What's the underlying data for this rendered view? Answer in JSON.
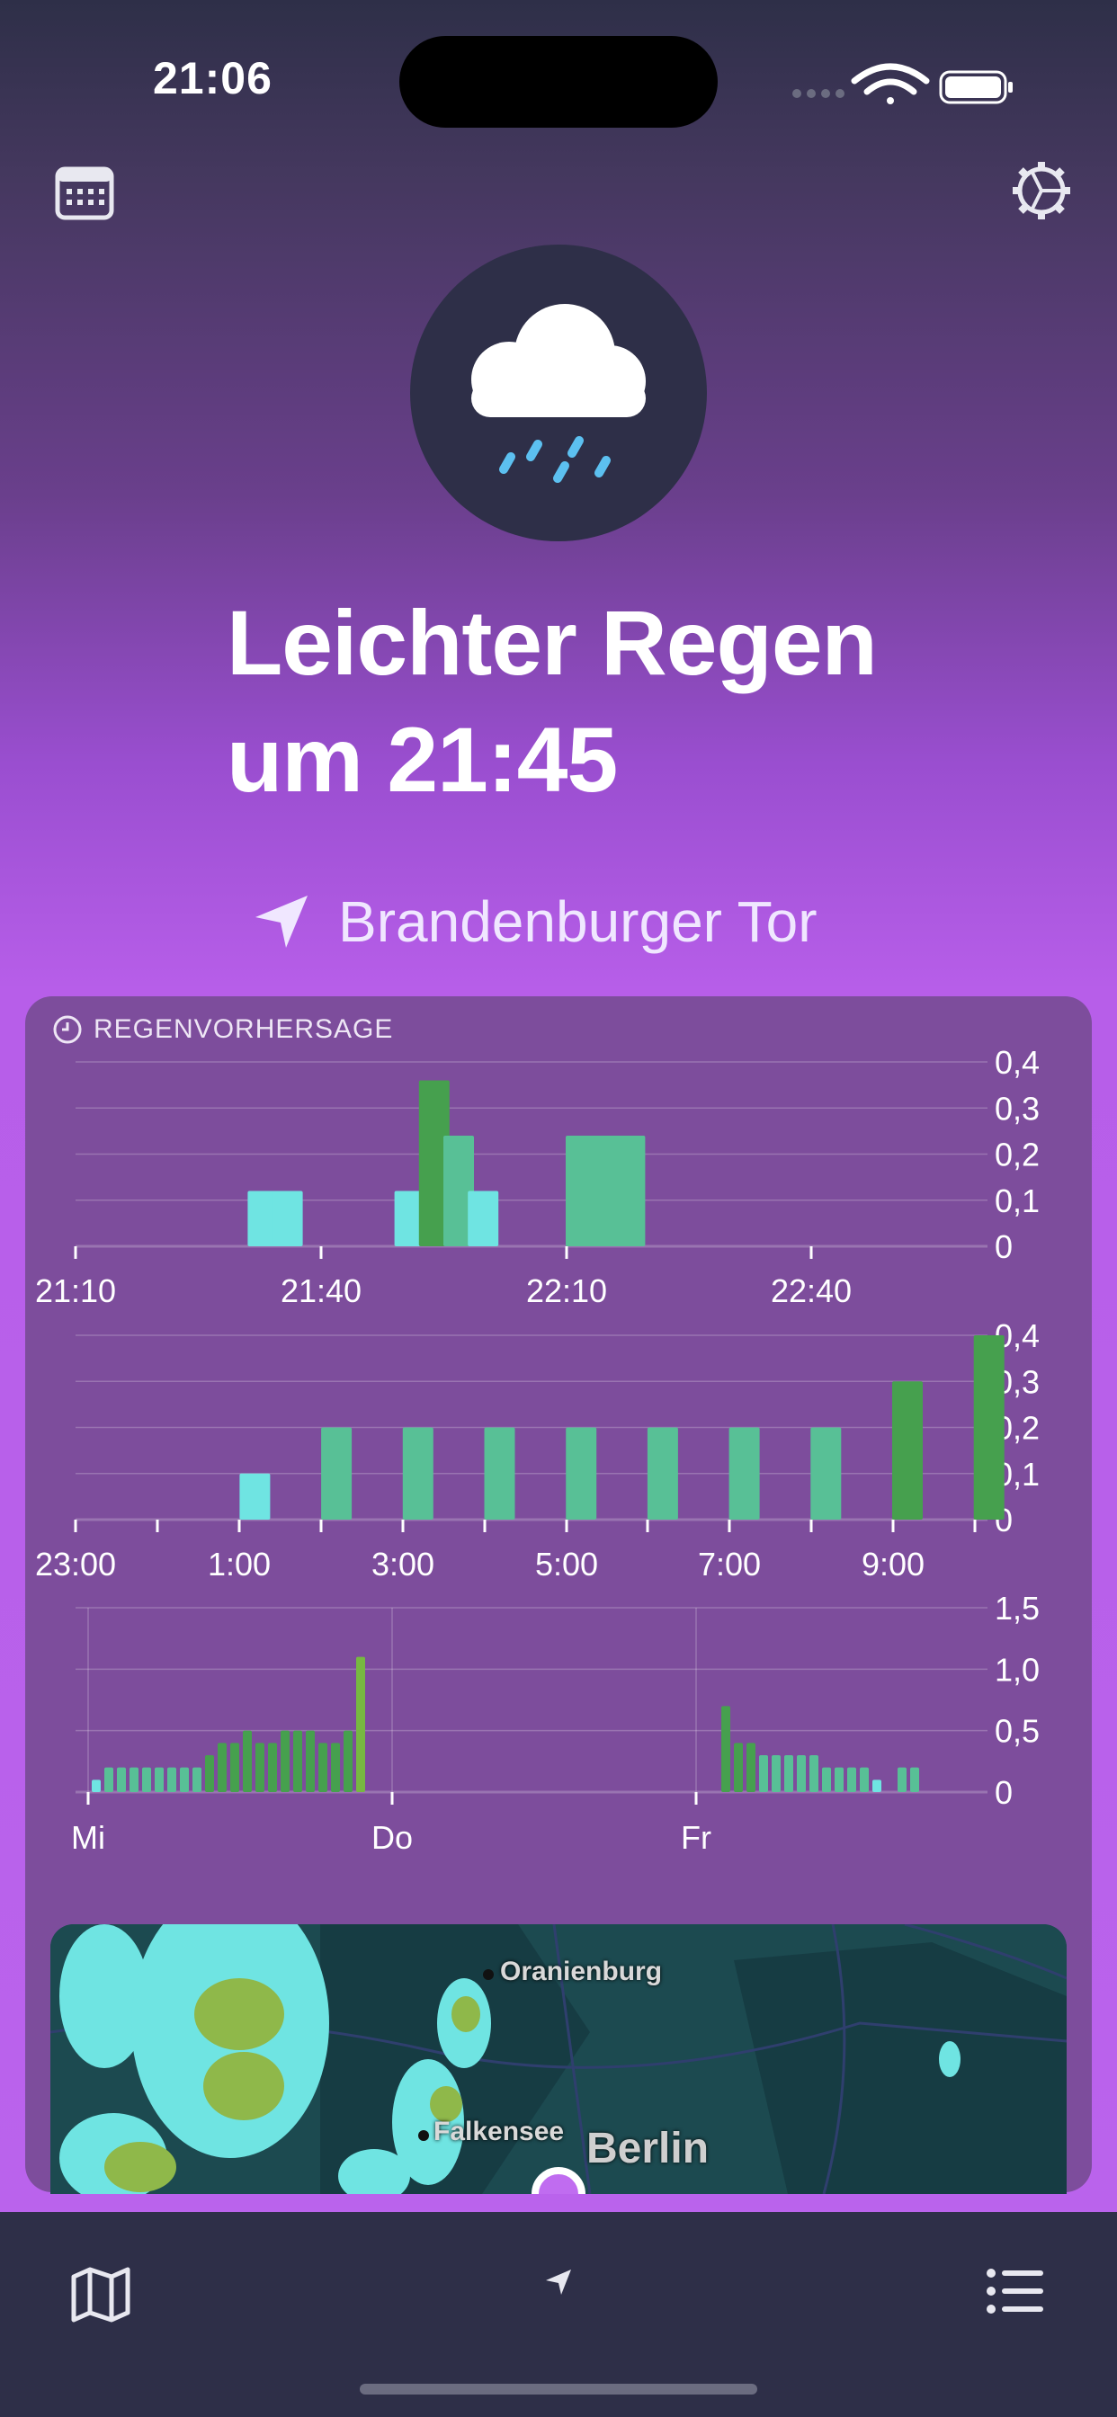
{
  "status_bar": {
    "time": "21:06"
  },
  "headline": {
    "line1": "Leichter Regen",
    "line2": "um 21:45"
  },
  "location": {
    "name": "Brandenburger Tor",
    "icon": "location-arrow-icon"
  },
  "forecast": {
    "title": "REGENVORHERSAGE"
  },
  "colors": {
    "cyan": "#6fe4e2",
    "green_light": "#58c096",
    "green_dark": "#46a04e",
    "green_lime": "#77b841"
  },
  "chart_data": [
    {
      "type": "bar",
      "x_tick_labels": [
        "21:10",
        "21:40",
        "22:10",
        "22:40"
      ],
      "y_tick_labels": [
        "0,4",
        "0,3",
        "0,2",
        "0,1",
        "0"
      ],
      "ylim": [
        0,
        0.4
      ],
      "bars": [
        {
          "slot": 7,
          "value": 0.12,
          "kind": "cyan"
        },
        {
          "slot": 8,
          "value": 0.12,
          "kind": "cyan"
        },
        {
          "slot": 13,
          "value": 0.12,
          "kind": "cyan"
        },
        {
          "slot": 14,
          "value": 0.36,
          "kind": "dark"
        },
        {
          "slot": 15,
          "value": 0.24,
          "kind": "light"
        },
        {
          "slot": 16,
          "value": 0.12,
          "kind": "cyan"
        },
        {
          "slot": 20,
          "value": 0.24,
          "kind": "light"
        },
        {
          "slot": 21,
          "value": 0.24,
          "kind": "light"
        },
        {
          "slot": 22,
          "value": 0.24,
          "kind": "light"
        }
      ]
    },
    {
      "type": "bar",
      "x_tick_labels": [
        "23:00",
        "1:00",
        "3:00",
        "5:00",
        "7:00",
        "9:00"
      ],
      "y_tick_labels": [
        "0,4",
        "0,3",
        "0,2",
        "0,1",
        "0"
      ],
      "ylim": [
        0,
        0.4
      ],
      "bars": [
        {
          "slot": 2,
          "value": 0.1,
          "kind": "cyan"
        },
        {
          "slot": 3,
          "value": 0.2,
          "kind": "light"
        },
        {
          "slot": 4,
          "value": 0.2,
          "kind": "light"
        },
        {
          "slot": 5,
          "value": 0.2,
          "kind": "light"
        },
        {
          "slot": 6,
          "value": 0.2,
          "kind": "light"
        },
        {
          "slot": 7,
          "value": 0.2,
          "kind": "light"
        },
        {
          "slot": 8,
          "value": 0.2,
          "kind": "light"
        },
        {
          "slot": 9,
          "value": 0.2,
          "kind": "light"
        },
        {
          "slot": 10,
          "value": 0.3,
          "kind": "dark"
        },
        {
          "slot": 11,
          "value": 0.4,
          "kind": "dark"
        }
      ]
    },
    {
      "type": "bar",
      "x_tick_labels": [
        "Mi",
        "Do",
        "Fr"
      ],
      "y_tick_labels": [
        "1,5",
        "1,0",
        "0,5",
        "0"
      ],
      "ylim": [
        0,
        1.5
      ],
      "bars": [
        {
          "slot": 0,
          "value": 0.1,
          "kind": "cyan"
        },
        {
          "slot": 1,
          "value": 0.2,
          "kind": "light"
        },
        {
          "slot": 2,
          "value": 0.2,
          "kind": "light"
        },
        {
          "slot": 3,
          "value": 0.2,
          "kind": "light"
        },
        {
          "slot": 4,
          "value": 0.2,
          "kind": "light"
        },
        {
          "slot": 5,
          "value": 0.2,
          "kind": "light"
        },
        {
          "slot": 6,
          "value": 0.2,
          "kind": "light"
        },
        {
          "slot": 7,
          "value": 0.2,
          "kind": "light"
        },
        {
          "slot": 8,
          "value": 0.2,
          "kind": "light"
        },
        {
          "slot": 9,
          "value": 0.3,
          "kind": "dark"
        },
        {
          "slot": 10,
          "value": 0.4,
          "kind": "dark"
        },
        {
          "slot": 11,
          "value": 0.4,
          "kind": "dark"
        },
        {
          "slot": 12,
          "value": 0.5,
          "kind": "dark"
        },
        {
          "slot": 13,
          "value": 0.4,
          "kind": "dark"
        },
        {
          "slot": 14,
          "value": 0.4,
          "kind": "dark"
        },
        {
          "slot": 15,
          "value": 0.5,
          "kind": "dark"
        },
        {
          "slot": 16,
          "value": 0.5,
          "kind": "dark"
        },
        {
          "slot": 17,
          "value": 0.5,
          "kind": "dark"
        },
        {
          "slot": 18,
          "value": 0.4,
          "kind": "dark"
        },
        {
          "slot": 19,
          "value": 0.4,
          "kind": "dark"
        },
        {
          "slot": 20,
          "value": 0.5,
          "kind": "dark"
        },
        {
          "slot": 21,
          "value": 1.1,
          "kind": "lime"
        },
        {
          "slot": 50,
          "value": 0.7,
          "kind": "dark"
        },
        {
          "slot": 51,
          "value": 0.4,
          "kind": "dark"
        },
        {
          "slot": 52,
          "value": 0.4,
          "kind": "dark"
        },
        {
          "slot": 53,
          "value": 0.3,
          "kind": "light"
        },
        {
          "slot": 54,
          "value": 0.3,
          "kind": "light"
        },
        {
          "slot": 55,
          "value": 0.3,
          "kind": "light"
        },
        {
          "slot": 56,
          "value": 0.3,
          "kind": "light"
        },
        {
          "slot": 57,
          "value": 0.3,
          "kind": "light"
        },
        {
          "slot": 58,
          "value": 0.2,
          "kind": "light"
        },
        {
          "slot": 59,
          "value": 0.2,
          "kind": "light"
        },
        {
          "slot": 60,
          "value": 0.2,
          "kind": "light"
        },
        {
          "slot": 61,
          "value": 0.2,
          "kind": "light"
        },
        {
          "slot": 62,
          "value": 0.1,
          "kind": "cyan"
        },
        {
          "slot": 64,
          "value": 0.2,
          "kind": "light"
        },
        {
          "slot": 65,
          "value": 0.2,
          "kind": "light"
        }
      ]
    }
  ],
  "map": {
    "labels": [
      "Oranienburg",
      "Falkensee",
      "Berlin"
    ]
  },
  "tab_bar": {
    "left_icon": "map-icon",
    "center_icon": "location-arrow-icon",
    "right_icon": "list-icon"
  }
}
